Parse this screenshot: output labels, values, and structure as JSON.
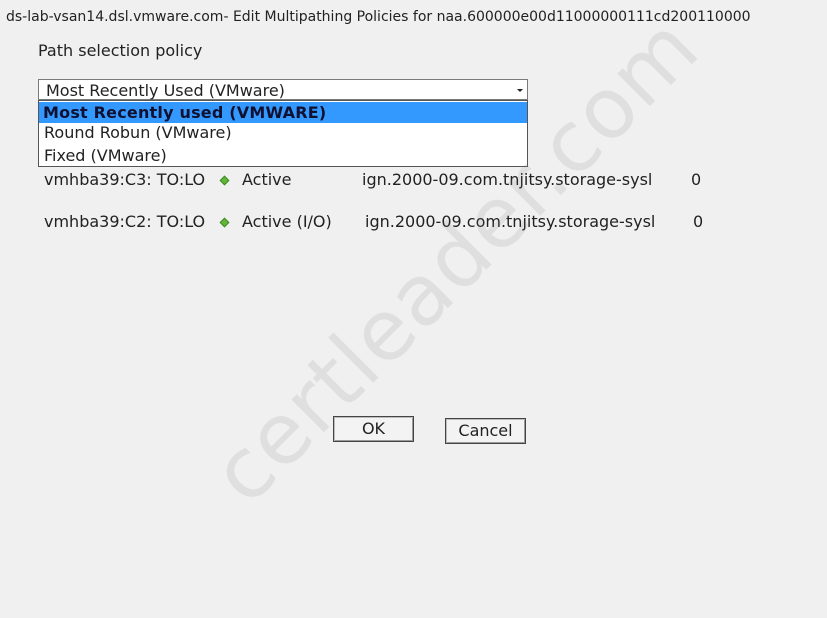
{
  "dialog": {
    "title": "ds-lab-vsan14.dsl.vmware.com- Edit Multipathing Policies for naa.600000e00d11000000111cd200110000"
  },
  "path_selection": {
    "label": "Path selection policy",
    "selected_value": "Most Recently Used (VMware)",
    "options": [
      {
        "label": "Most Recently used (VMWARE)",
        "highlighted": true
      },
      {
        "label": "Round Robun (VMware)",
        "highlighted": false
      },
      {
        "label": "Fixed (VMware)",
        "highlighted": false
      }
    ]
  },
  "paths": [
    {
      "runtime_name": "vmhba39:C3: TO:LO",
      "status": "Active",
      "target": "ign.2000-09.com.tnjitsy.storage-sysl",
      "lun": "0"
    },
    {
      "runtime_name": "vmhba39:C2: TO:LO",
      "status": "Active (I/O)",
      "target": "ign.2000-09.com.tnjitsy.storage-sysl",
      "lun": "0"
    }
  ],
  "buttons": {
    "ok": "OK",
    "cancel": "Cancel"
  },
  "watermark": "certleader.com",
  "colors": {
    "background": "#f0f0f0",
    "highlight": "#3399ff",
    "status_active": "#62b63a"
  },
  "icons": {
    "dropdown": "chevron-down-icon",
    "status": "green-diamond-status-icon"
  }
}
